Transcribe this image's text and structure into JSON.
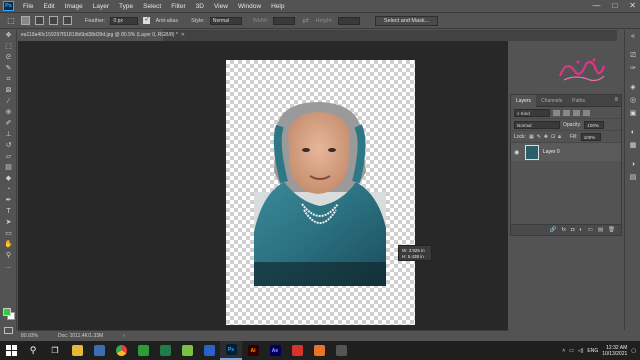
{
  "menu": {
    "app_logo": "Ps",
    "items": [
      "File",
      "Edit",
      "Image",
      "Layer",
      "Type",
      "Select",
      "Filter",
      "3D",
      "View",
      "Window",
      "Help"
    ],
    "window_controls": [
      "—",
      "□",
      "✕"
    ]
  },
  "options": {
    "feather_label": "Feather:",
    "feather_value": "0 px",
    "anti_alias_label": "Anti-alias",
    "style_label": "Style:",
    "style_value": "Normal",
    "width_label": "Width:",
    "height_label": "Height:",
    "select_mask_label": "Select and Mask..."
  },
  "document": {
    "tab_title": "ea119a40c159297f51819b6bd38d39d.jpg @ 80.9% (Layer 0, RGB/8) *",
    "close_glyph": "✕"
  },
  "transform_tooltip": {
    "w_line": "W:  3.925 in",
    "h_line": "H:  5.438 in"
  },
  "status": {
    "zoom": "80.93%",
    "doc_info": "Doc: 1011.4K/1.33M",
    "arrow": "›"
  },
  "layers_panel": {
    "tabs": [
      "Layers",
      "Channels",
      "Paths"
    ],
    "menu_glyph": "≡",
    "kind_label": "Kind",
    "blend_mode": "Normal",
    "opacity_label": "Opacity:",
    "opacity_value": "100%",
    "lock_label": "Lock:",
    "fill_label": "Fill:",
    "fill_value": "100%",
    "layer_name": "Layer 0",
    "footer_icons": [
      "🔗",
      "fx",
      "◘",
      "◐",
      "▭",
      "▤",
      "🗑"
    ]
  },
  "taskbar": {
    "lang": "ENG",
    "time": "12:32 AM",
    "date": "10/13/2021",
    "apps": [
      "Ps",
      "Ai",
      "Ae"
    ]
  },
  "colors": {
    "foreground": "#2ecc40",
    "background": "#ffffff",
    "accent": "#31a8ff"
  }
}
